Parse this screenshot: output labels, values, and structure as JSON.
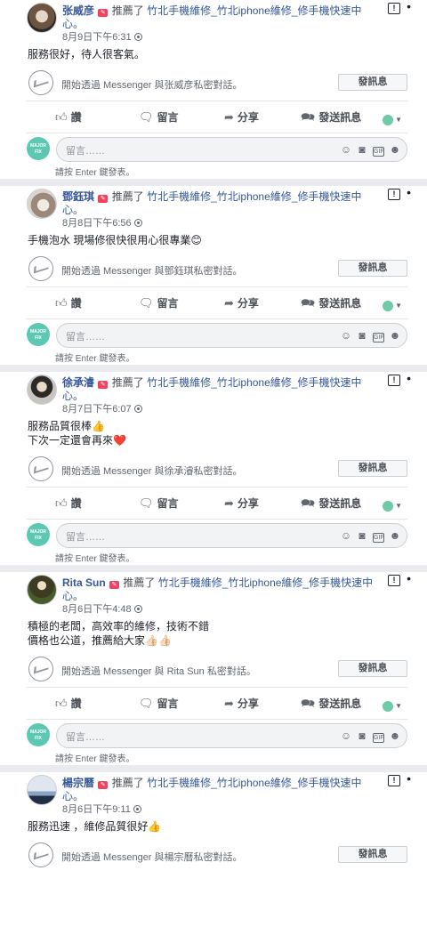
{
  "recommend_text": "推薦了",
  "page_name": "竹北手機維修_竹北iphone維修_修手機快速中心",
  "page_suffix": "。",
  "messenger_template": "開始透過 Messenger 與{name}私密對話。",
  "send_message_button": "發訊息",
  "actions": {
    "like": "讚",
    "comment": "留言",
    "share": "分享",
    "send": "發送訊息"
  },
  "comment_placeholder": "留言……",
  "enter_hint": "請按 Enter 鍵發表。",
  "commenter_logo_text": "MAJOR FIX",
  "colors": {
    "link": "#365899",
    "separator": "#e9ebee",
    "recommend_icon": "#f3425f",
    "major_fix_green": "#5cc8b2"
  },
  "posts": [
    {
      "name": "张威彦",
      "messenger_name": "张威彦",
      "date": "8月9日下午6:31",
      "text": "服務很好，待人很客氣。",
      "messenger_text": "開始透過 Messenger 與张威彦私密對話。"
    },
    {
      "name": "鄧鈺琪",
      "date": "8月8日下午6:56",
      "text": "手機泡水 現場修很快很用心很專業😊",
      "messenger_text": "開始透過 Messenger 與鄧鈺琪私密對話。"
    },
    {
      "name": "徐承濬",
      "date": "8月7日下午6:07",
      "text": "服務品質很棒👍\n下次一定還會再來❤️",
      "messenger_text": "開始透過 Messenger 與徐承濬私密對話。"
    },
    {
      "name": "Rita Sun",
      "date": "8月6日下午4:48",
      "text": "積極的老闆，高效率的維修，技術不錯\n價格也公道，推薦給大家👍🏻👍🏻",
      "messenger_text": "開始透過 Messenger 與 Rita Sun 私密對話。"
    },
    {
      "name": "楊宗曆",
      "date": "8月6日下午9:11",
      "text": "服務迅速 ，維修品質很好👍",
      "messenger_text": "開始透過 Messenger 與楊宗曆私密對話。"
    }
  ]
}
